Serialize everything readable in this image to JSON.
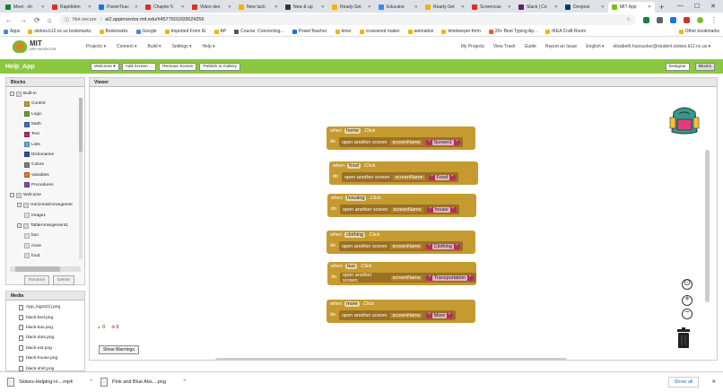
{
  "browser": {
    "tabs": [
      {
        "label": "Meet - sh",
        "color": "#188038"
      },
      {
        "label": "Rapididen",
        "color": "#d93025"
      },
      {
        "label": "PowerTeac",
        "color": "#1a73e8"
      },
      {
        "label": "Chapter 5",
        "color": "#d93025"
      },
      {
        "label": "Video den",
        "color": "#d93025"
      },
      {
        "label": "New tacti",
        "color": "#f4b400"
      },
      {
        "label": "New & up",
        "color": "#333333"
      },
      {
        "label": "Ready-Set",
        "color": "#f4b400"
      },
      {
        "label": "Educator",
        "color": "#4285f4"
      },
      {
        "label": "Ready-Set",
        "color": "#f4b400"
      },
      {
        "label": "Screencas",
        "color": "#d93025"
      },
      {
        "label": "Slack | Co",
        "color": "#611f69"
      },
      {
        "label": "Devpost",
        "color": "#003e54"
      },
      {
        "label": "MIT App",
        "color": "#7cbb27",
        "active": true
      }
    ],
    "new_tab": "+",
    "url": "ai2.appinventor.mit.edu/#4577601693024256",
    "not_secure": "Not secure",
    "bookmarks": [
      {
        "label": "Apps",
        "color": "#4285f4"
      },
      {
        "label": "stokes.k12.nc.us bookmarks",
        "color": "#f4b400"
      },
      {
        "label": "Bookmarks",
        "color": "#f4b400"
      },
      {
        "label": "Google",
        "color": "#4285f4"
      },
      {
        "label": "Imported From IE",
        "color": "#f4b400"
      },
      {
        "label": "AP",
        "color": "#f4b400"
      },
      {
        "label": "Course: Connecting...",
        "color": "#555555"
      },
      {
        "label": "PowerTeacher",
        "color": "#1a73e8"
      },
      {
        "label": "timer",
        "color": "#f4b400"
      },
      {
        "label": "crossword maker",
        "color": "#f4b400"
      },
      {
        "label": "animation",
        "color": "#f4b400"
      },
      {
        "label": "timekeeper-form",
        "color": "#f4b400"
      },
      {
        "label": "20+ Best Typing Ap...",
        "color": "#ff5722"
      },
      {
        "label": "IKEA Craft Room",
        "color": "#f4b400"
      },
      {
        "label": "Other bookmarks",
        "color": "#f4b400"
      }
    ]
  },
  "ai_header": {
    "logo_title": "MIT",
    "logo_sub": "APP INVENTOR",
    "menus": [
      "Projects ▾",
      "Connect ▾",
      "Build ▾",
      "Settings ▾",
      "Help ▾"
    ],
    "links": [
      "My Projects",
      "View Trash",
      "Guide",
      "Report an Issue",
      "English ▾",
      "elizabeth.hunsucker@student.stokes.k12.nc.us ▾"
    ]
  },
  "project_bar": {
    "name": "Help_App",
    "buttons": [
      "Welcome ▾",
      "Add Screen ...",
      "Remove Screen",
      "Publish to Gallery"
    ],
    "designer": "Designer",
    "blocks": "Blocks"
  },
  "blocks_panel": {
    "title": "Blocks",
    "tree": [
      {
        "label": "Built-in",
        "level": 0,
        "toggle": "−"
      },
      {
        "label": "Control",
        "level": 2,
        "color": "#c59a30"
      },
      {
        "label": "Logic",
        "level": 2,
        "color": "#6b9b3a"
      },
      {
        "label": "Math",
        "level": 2,
        "color": "#3f71b5"
      },
      {
        "label": "Text",
        "level": 2,
        "color": "#b32d5e"
      },
      {
        "label": "Lists",
        "level": 2,
        "color": "#65aadc"
      },
      {
        "label": "Dictionaries",
        "level": 2,
        "color": "#2d4ca3"
      },
      {
        "label": "Colors",
        "level": 2,
        "color": "#7d7d7d"
      },
      {
        "label": "Variables",
        "level": 2,
        "color": "#e0762c"
      },
      {
        "label": "Procedures",
        "level": 2,
        "color": "#7b4ea3"
      },
      {
        "label": "Welcome",
        "level": 0,
        "toggle": "−"
      },
      {
        "label": "HorizontalArrangemer",
        "level": 1,
        "toggle": "−"
      },
      {
        "label": "Image1",
        "level": 2,
        "color": "#dddddd"
      },
      {
        "label": "TableArrangement1",
        "level": 1,
        "toggle": "−"
      },
      {
        "label": "bus",
        "level": 2,
        "color": "#dddddd"
      },
      {
        "label": "more",
        "level": 2,
        "color": "#dddddd"
      },
      {
        "label": "food",
        "level": 2,
        "color": "#dddddd"
      }
    ],
    "rename": "Rename",
    "delete": "Delete"
  },
  "media_panel": {
    "title": "Media",
    "items": [
      "App_logo2(1).png",
      "black-bed.png",
      "black-bus.png",
      "black-dots.png",
      "black-eat.png",
      "black-house.png",
      "black-shirt.png"
    ]
  },
  "viewer": {
    "title": "Viewer",
    "event_blocks": [
      {
        "component": "home",
        "screen": "Screen1"
      },
      {
        "component": "food",
        "screen": "Food"
      },
      {
        "component": "housing",
        "screen": "house"
      },
      {
        "component": "clothing",
        "screen": "Clothing"
      },
      {
        "component": "bus",
        "screen": "Transportation"
      },
      {
        "component": "more",
        "screen": "More"
      }
    ],
    "when": "when",
    "click": ".Click",
    "do": "do",
    "open_screen": "open another screen",
    "screen_name": "screenName",
    "warnings_count": "0",
    "errors_count": "0",
    "show_warnings": "Show Warnings"
  },
  "downloads": {
    "items": [
      "Stokes-Helping-H....mp4",
      "Pink and Blue Abs....png"
    ],
    "show_all": "Show all"
  }
}
